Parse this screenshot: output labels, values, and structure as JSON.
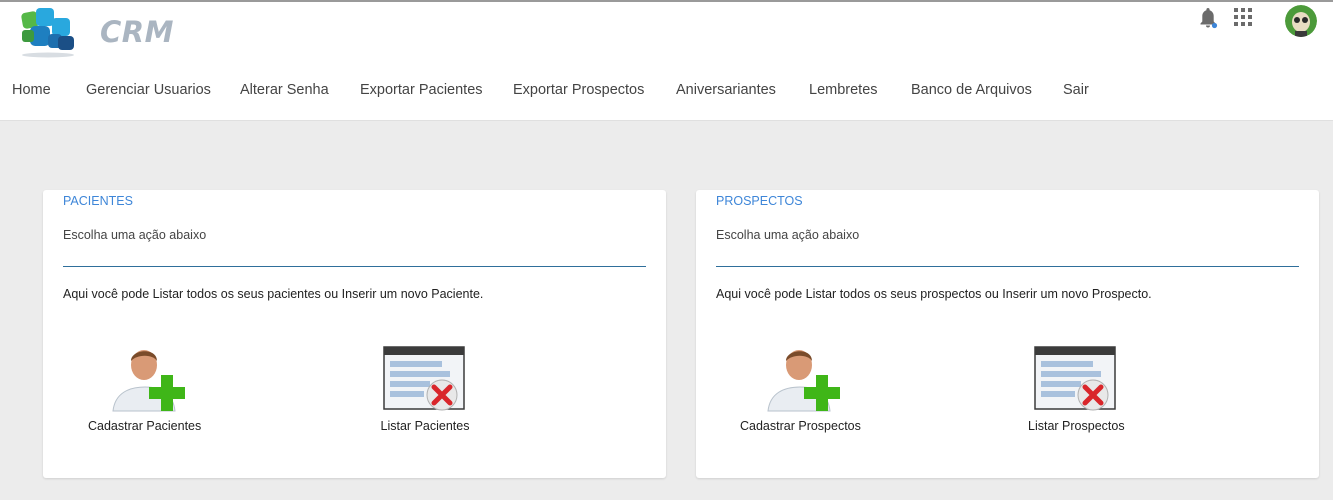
{
  "app": {
    "brand": "CRM"
  },
  "icons": {
    "logo": "crm-logo-icon",
    "notifications": "bell-icon",
    "apps": "apps-grid-icon",
    "user": "user-avatar"
  },
  "nav": {
    "items": [
      {
        "label": "Home"
      },
      {
        "label": "Gerenciar Usuarios"
      },
      {
        "label": "Alterar Senha"
      },
      {
        "label": "Exportar Pacientes"
      },
      {
        "label": "Exportar Prospectos"
      },
      {
        "label": "Aniversariantes"
      },
      {
        "label": "Lembretes"
      },
      {
        "label": "Banco de Arquivos"
      },
      {
        "label": "Sair"
      }
    ]
  },
  "cards": [
    {
      "title": "PACIENTES",
      "subtitle": "Escolha uma ação abaixo",
      "description": "Aqui você pode Listar todos os seus pacientes ou Inserir um novo Paciente.",
      "actions": [
        {
          "label": "Cadastrar Pacientes",
          "icon": "add-user-icon"
        },
        {
          "label": "Listar Pacientes",
          "icon": "list-window-icon"
        }
      ]
    },
    {
      "title": "PROSPECTOS",
      "subtitle": "Escolha uma ação abaixo",
      "description": "Aqui você pode Listar todos os seus prospectos ou Inserir um novo Prospecto.",
      "actions": [
        {
          "label": "Cadastrar Prospectos",
          "icon": "add-user-icon"
        },
        {
          "label": "Listar Prospectos",
          "icon": "list-window-icon"
        }
      ]
    }
  ],
  "colors": {
    "accent": "#3e86d8",
    "background": "#ececec",
    "rule": "#2f6f9b",
    "plus_green": "#3fb618",
    "delete_red": "#d9262b"
  }
}
